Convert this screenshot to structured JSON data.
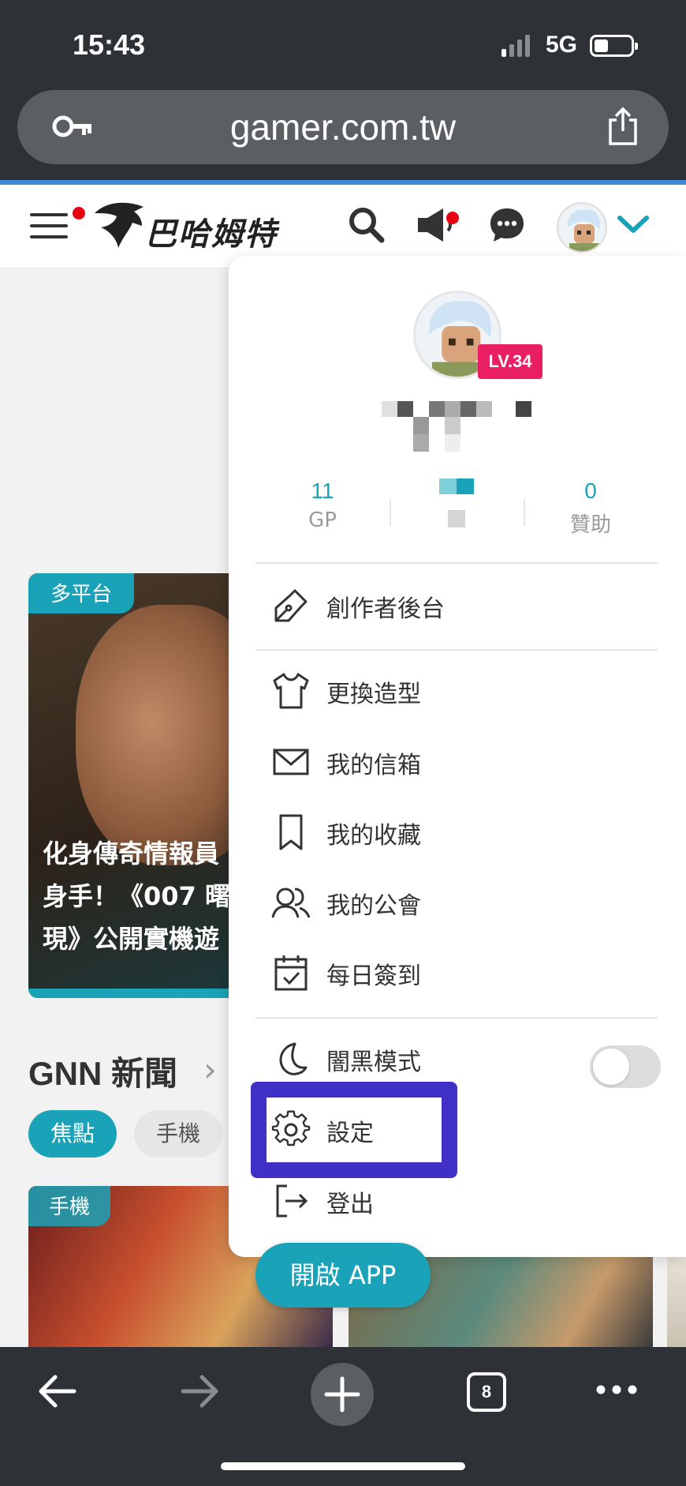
{
  "status_bar": {
    "time": "15:43",
    "network": "5G"
  },
  "browser": {
    "url": "gamer.com.tw",
    "tab_count": "8"
  },
  "site": {
    "logo_text": "巴哈姆特",
    "feature": {
      "tag": "多平台",
      "title_lines": [
        "化身傳奇情報員",
        "身手！《007 曙",
        "現》公開實機遊"
      ]
    },
    "gnn": {
      "title": "GNN 新聞",
      "chevron": "›",
      "tabs": [
        "焦點",
        "手機"
      ]
    },
    "thumb_tag": "手機",
    "open_app": "開啟 APP"
  },
  "menu": {
    "level_badge": "LV.34",
    "stats": [
      {
        "value": "11",
        "label": "GP"
      },
      {
        "value": "0",
        "label": "贊助"
      }
    ],
    "items": [
      {
        "label": "創作者後台",
        "icon": "pen-nib-icon"
      },
      {
        "label": "更換造型",
        "icon": "shirt-icon"
      },
      {
        "label": "我的信箱",
        "icon": "mail-icon"
      },
      {
        "label": "我的收藏",
        "icon": "bookmark-icon"
      },
      {
        "label": "我的公會",
        "icon": "users-icon"
      },
      {
        "label": "每日簽到",
        "icon": "calendar-check-icon"
      },
      {
        "label": "闇黑模式",
        "icon": "moon-icon",
        "toggle": false
      },
      {
        "label": "設定",
        "icon": "gear-icon"
      },
      {
        "label": "登出",
        "icon": "logout-icon"
      }
    ]
  },
  "colors": {
    "accent": "#1aa3b8",
    "highlight": "#4030c8",
    "badge": "#e91e63",
    "notify": "#e60012"
  }
}
